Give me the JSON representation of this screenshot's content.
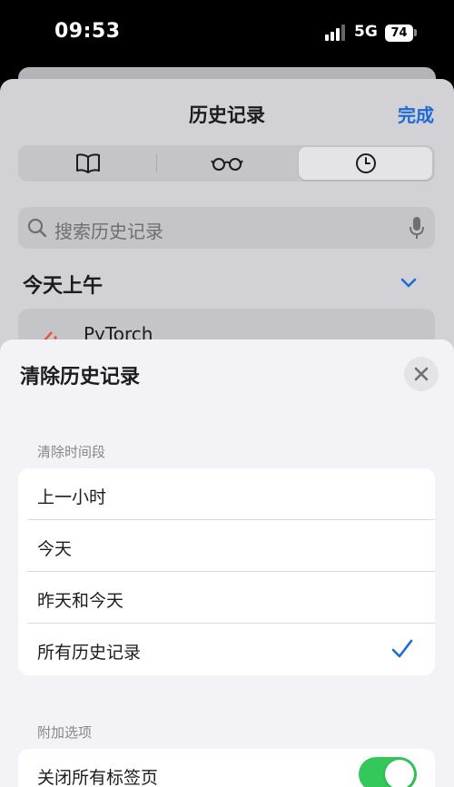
{
  "status_bar": {
    "time": "09:53",
    "network": "5G",
    "battery": "74"
  },
  "history": {
    "title": "历史记录",
    "done_label": "完成",
    "segments": [
      {
        "icon": "book-icon"
      },
      {
        "icon": "reading-list-glasses-icon"
      },
      {
        "icon": "clock-icon",
        "selected": true
      }
    ],
    "search_placeholder": "搜索历史记录",
    "section_title": "今天上午",
    "items": [
      {
        "title": "PyTorch",
        "icon": "pytorch-logo"
      }
    ]
  },
  "clear_dialog": {
    "title": "清除历史记录",
    "timeframe_header": "清除时间段",
    "options": [
      {
        "label": "上一小时",
        "selected": false
      },
      {
        "label": "今天",
        "selected": false
      },
      {
        "label": "昨天和今天",
        "selected": false
      },
      {
        "label": "所有历史记录",
        "selected": true
      }
    ],
    "extras_header": "附加选项",
    "extras": [
      {
        "label": "关闭所有标签页",
        "enabled": true
      }
    ]
  },
  "colors": {
    "accent": "#1a6bd6",
    "toggle_on": "#34c759"
  }
}
